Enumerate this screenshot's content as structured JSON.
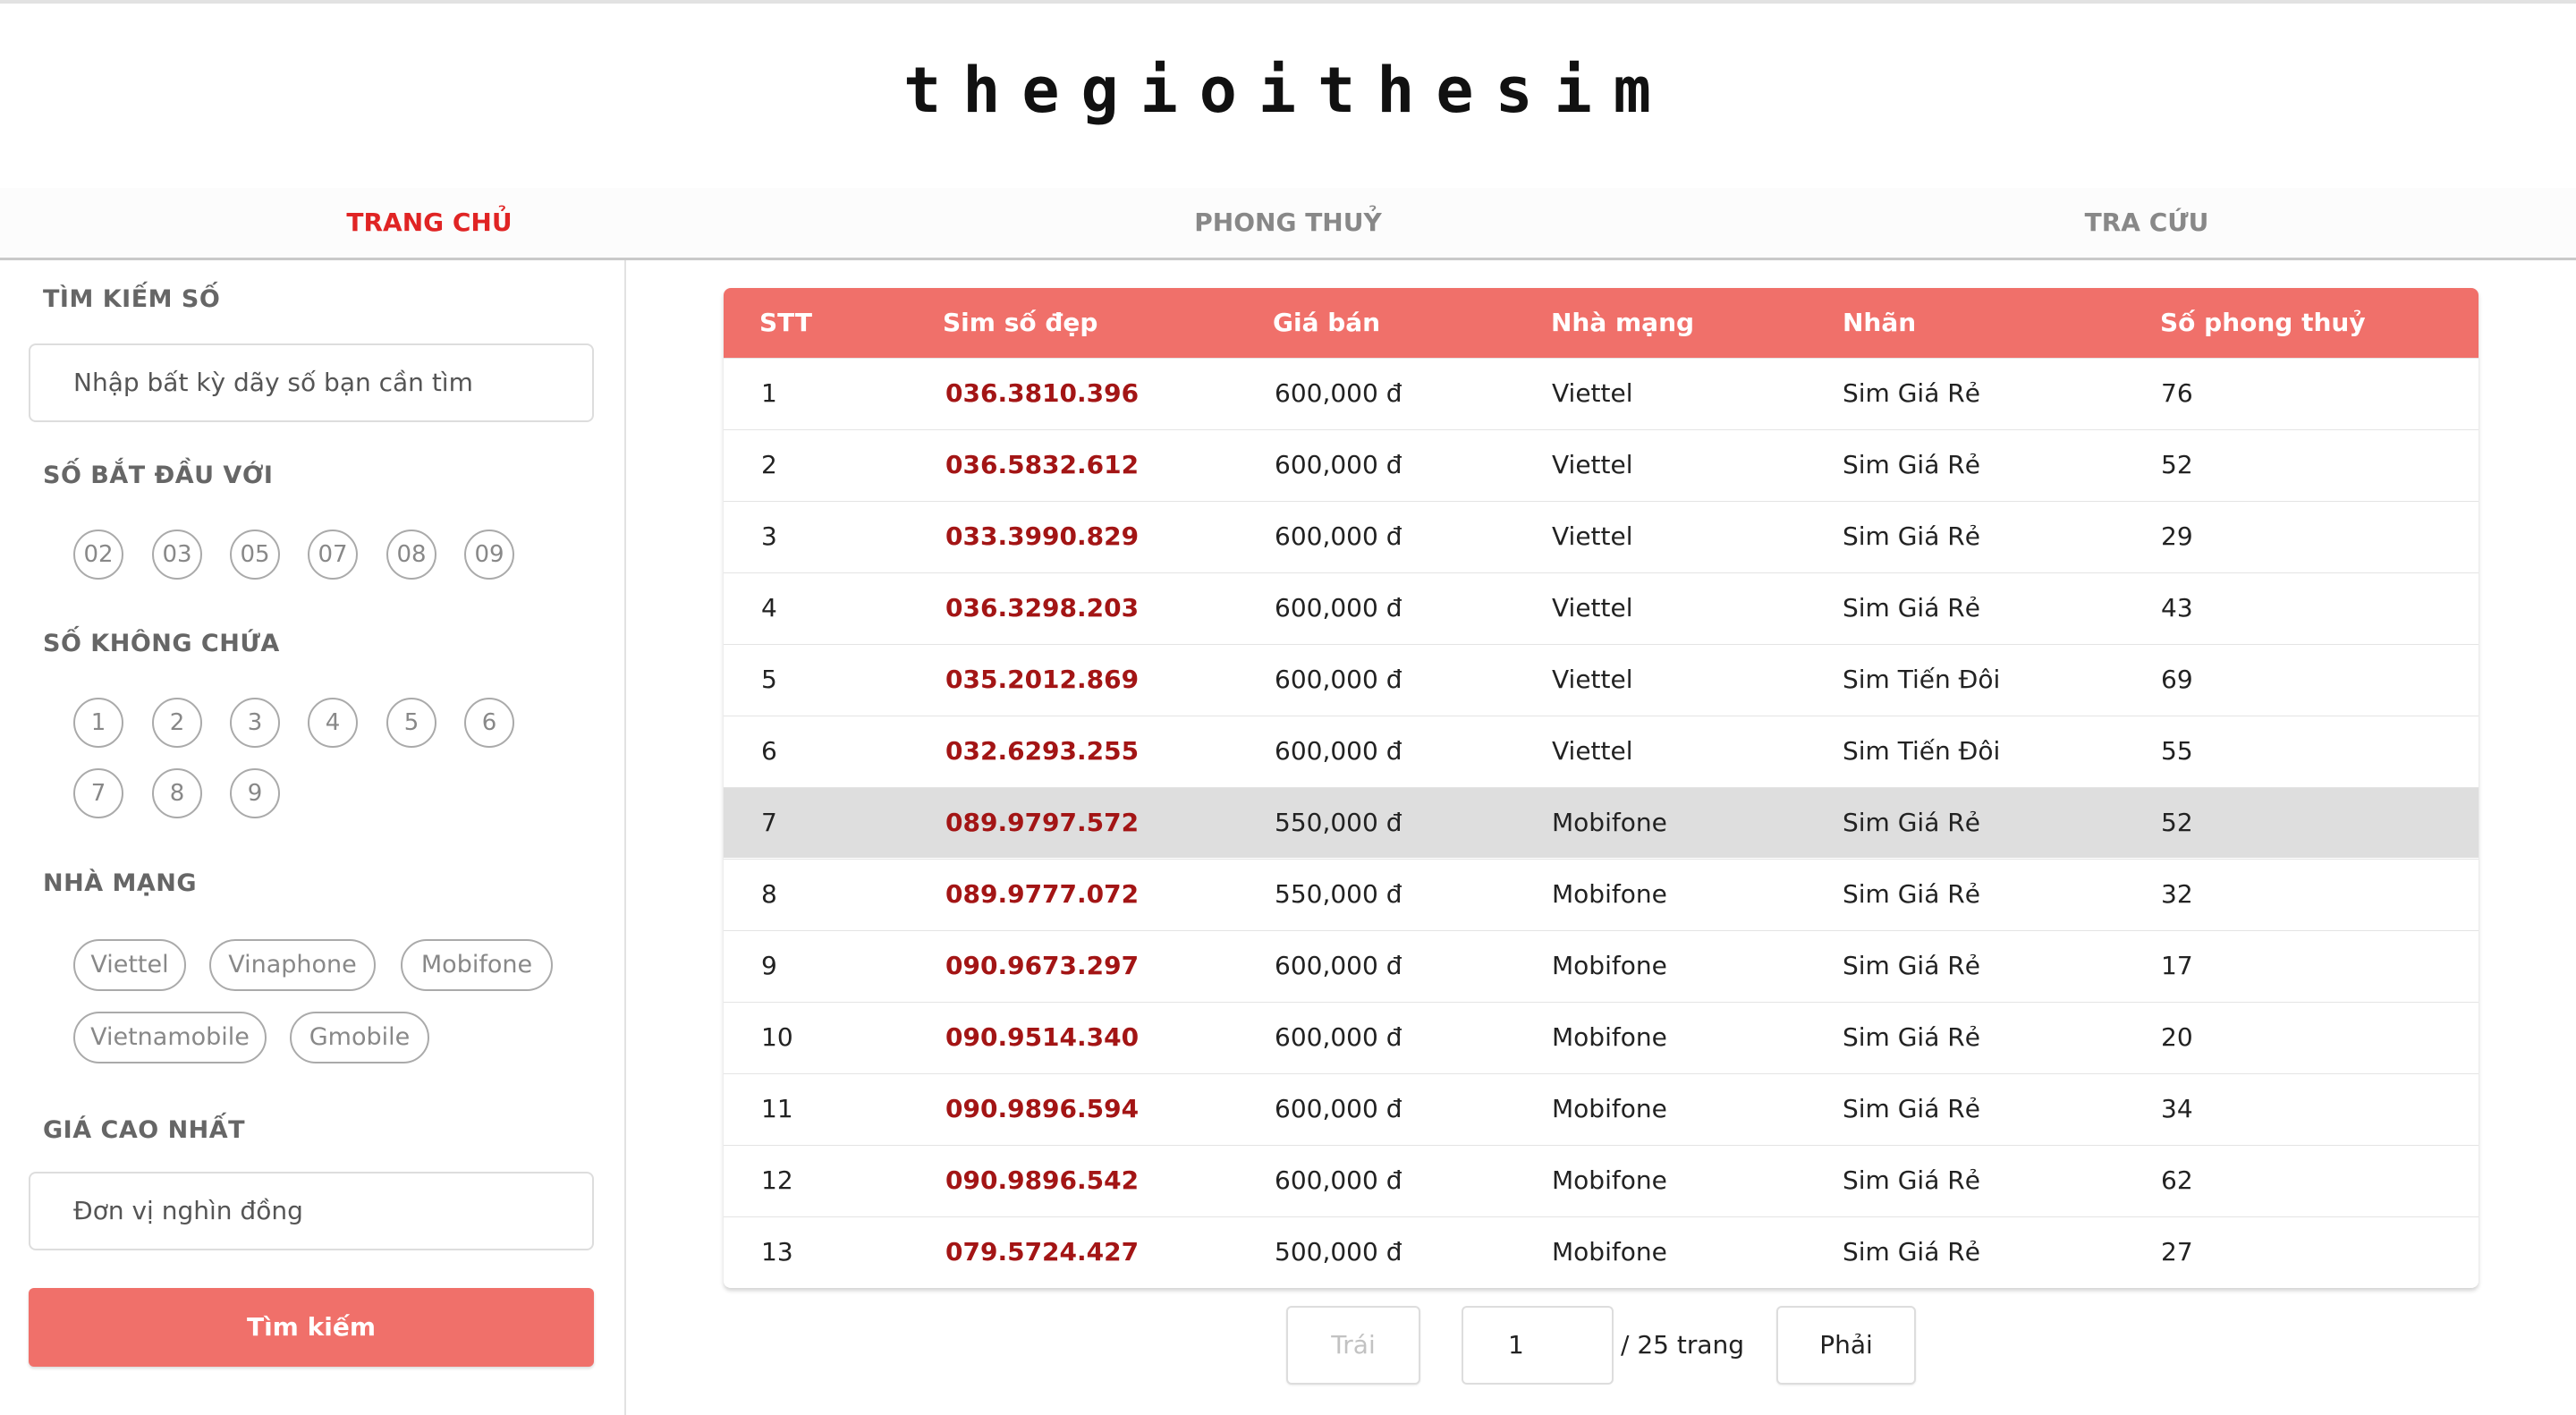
{
  "logo": "thegioithesim",
  "nav": {
    "items": [
      "TRANG CHỦ",
      "PHONG THUỶ",
      "TRA CỨU"
    ],
    "active_index": 0
  },
  "sidebar": {
    "search_title": "TÌM KIẾM SỐ",
    "search_placeholder": "Nhập bất kỳ dãy số bạn cần tìm",
    "prefix_title": "SỐ BẮT ĐẦU VỚI",
    "prefixes": [
      "02",
      "03",
      "05",
      "07",
      "08",
      "09"
    ],
    "exclude_title": "SỐ KHÔNG CHỨA",
    "exclude_digits": [
      "1",
      "2",
      "3",
      "4",
      "5",
      "6",
      "7",
      "8",
      "9"
    ],
    "carrier_title": "NHÀ MẠNG",
    "carriers": [
      "Viettel",
      "Vinaphone",
      "Mobifone",
      "Vietnamobile",
      "Gmobile"
    ],
    "price_title": "GIÁ CAO NHẤT",
    "price_placeholder": "Đơn vị nghìn đồng",
    "search_button": "Tìm kiếm"
  },
  "table": {
    "headers": [
      "STT",
      "Sim số đẹp",
      "Giá bán",
      "Nhà mạng",
      "Nhãn",
      "Số phong thuỷ"
    ],
    "highlight_row": 6,
    "rows": [
      [
        "1",
        "036.3810.396",
        "600,000 đ",
        "Viettel",
        "Sim Giá Rẻ",
        "76"
      ],
      [
        "2",
        "036.5832.612",
        "600,000 đ",
        "Viettel",
        "Sim Giá Rẻ",
        "52"
      ],
      [
        "3",
        "033.3990.829",
        "600,000 đ",
        "Viettel",
        "Sim Giá Rẻ",
        "29"
      ],
      [
        "4",
        "036.3298.203",
        "600,000 đ",
        "Viettel",
        "Sim Giá Rẻ",
        "43"
      ],
      [
        "5",
        "035.2012.869",
        "600,000 đ",
        "Viettel",
        "Sim Tiến Đôi",
        "69"
      ],
      [
        "6",
        "032.6293.255",
        "600,000 đ",
        "Viettel",
        "Sim Tiến Đôi",
        "55"
      ],
      [
        "7",
        "089.9797.572",
        "550,000 đ",
        "Mobifone",
        "Sim Giá Rẻ",
        "52"
      ],
      [
        "8",
        "089.9777.072",
        "550,000 đ",
        "Mobifone",
        "Sim Giá Rẻ",
        "32"
      ],
      [
        "9",
        "090.9673.297",
        "600,000 đ",
        "Mobifone",
        "Sim Giá Rẻ",
        "17"
      ],
      [
        "10",
        "090.9514.340",
        "600,000 đ",
        "Mobifone",
        "Sim Giá Rẻ",
        "20"
      ],
      [
        "11",
        "090.9896.594",
        "600,000 đ",
        "Mobifone",
        "Sim Giá Rẻ",
        "34"
      ],
      [
        "12",
        "090.9896.542",
        "600,000 đ",
        "Mobifone",
        "Sim Giá Rẻ",
        "62"
      ],
      [
        "13",
        "079.5724.427",
        "500,000 đ",
        "Mobifone",
        "Sim Giá Rẻ",
        "27"
      ]
    ]
  },
  "pagination": {
    "prev_label": "Trái",
    "prev_disabled": true,
    "current_page": "1",
    "total_label": "/ 25 trang",
    "next_label": "Phải"
  },
  "colors": {
    "accent": "#f0706a",
    "active_nav": "#e02424",
    "sim_number": "#a31515",
    "highlight_row": "#dedede"
  }
}
